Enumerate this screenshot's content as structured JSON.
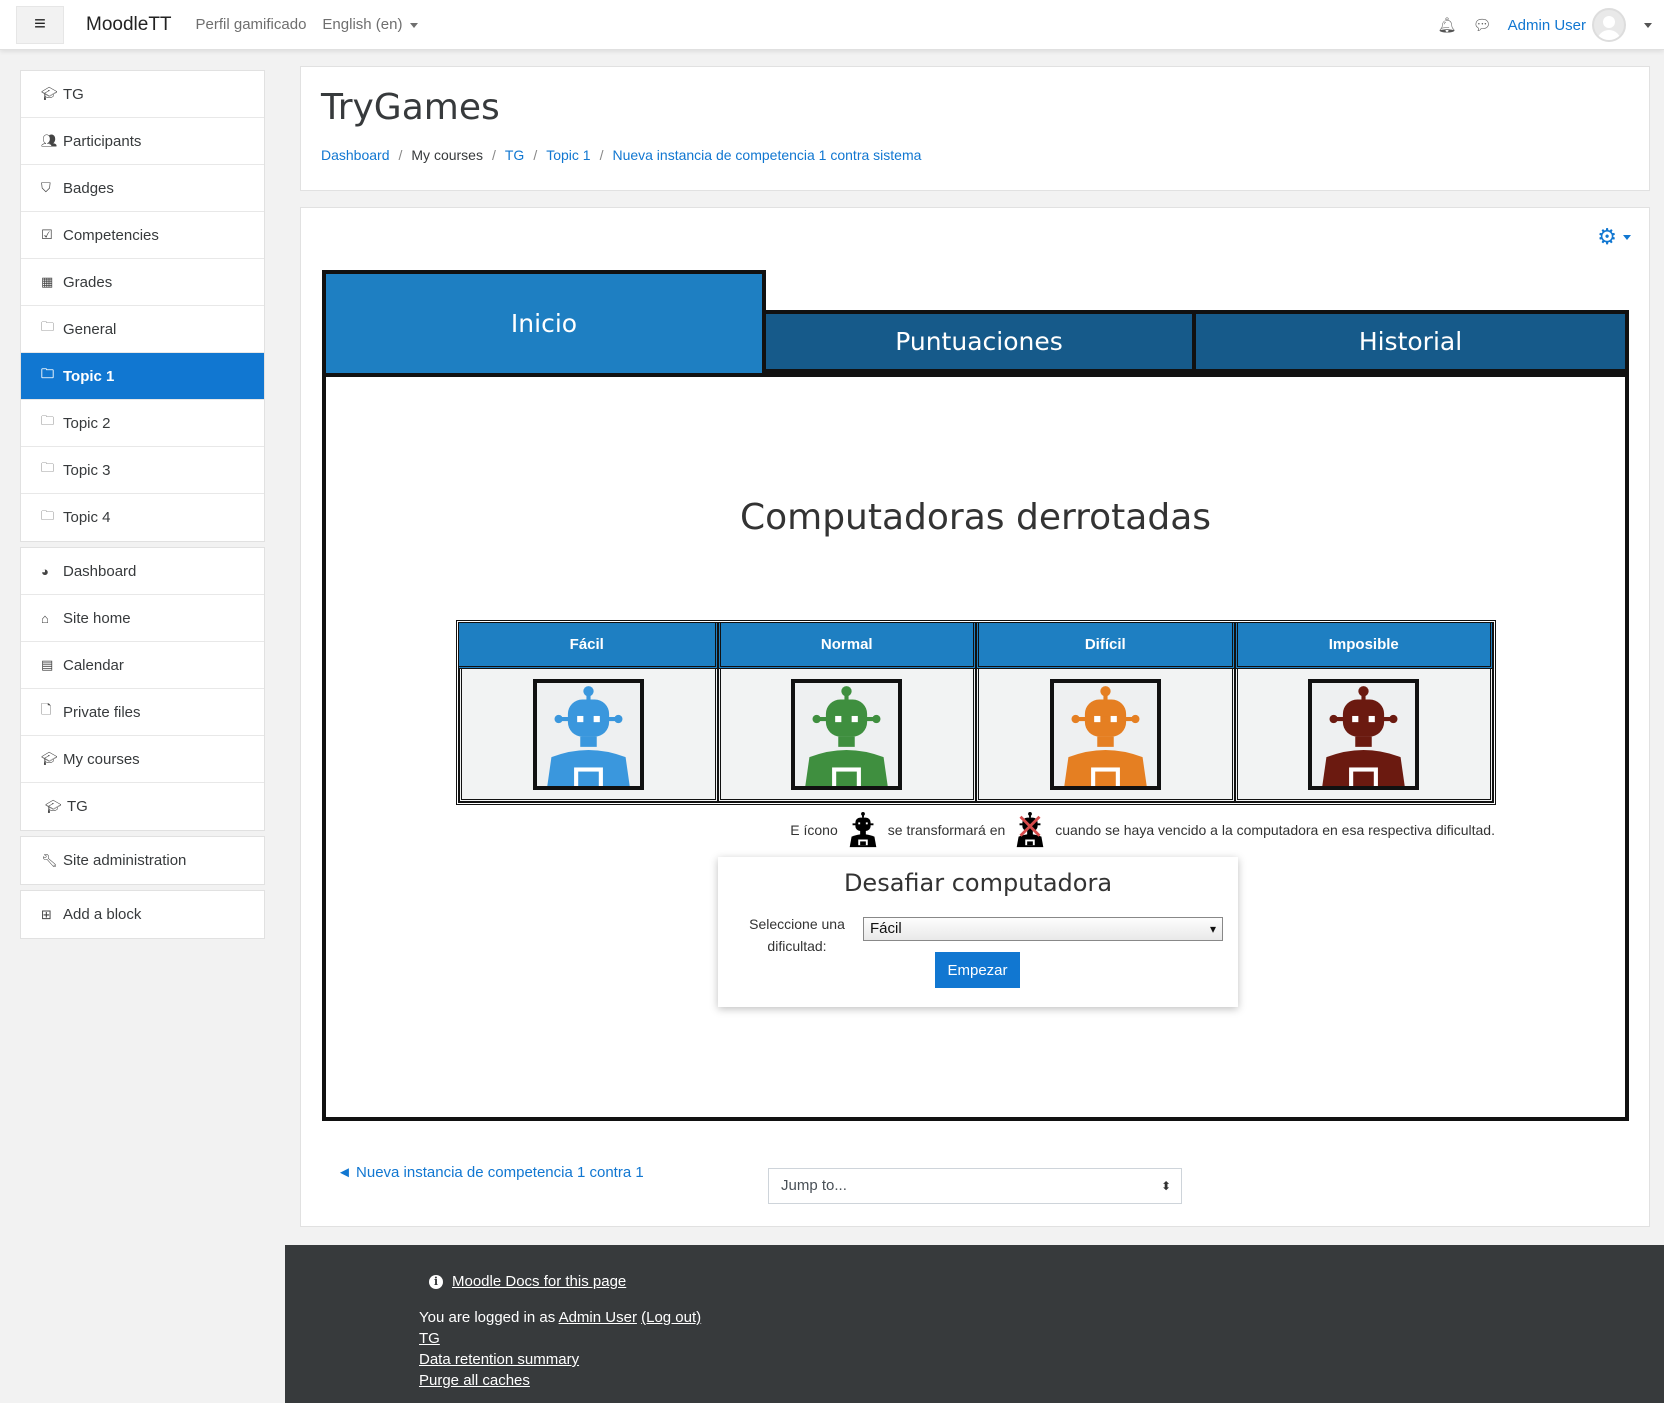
{
  "navbar": {
    "brand": "MoodleTT",
    "links": [
      "Perfil gamificado"
    ],
    "language": "English (en)",
    "user": "Admin User"
  },
  "sidebar": {
    "group1": [
      {
        "label": "TG",
        "icon": "graduation-cap-icon"
      },
      {
        "label": "Participants",
        "icon": "users-icon"
      },
      {
        "label": "Badges",
        "icon": "shield-icon"
      },
      {
        "label": "Competencies",
        "icon": "check-square-icon"
      },
      {
        "label": "Grades",
        "icon": "table-icon"
      },
      {
        "label": "General",
        "icon": "folder-icon"
      },
      {
        "label": "Topic 1",
        "icon": "folder-icon",
        "active": true
      },
      {
        "label": "Topic 2",
        "icon": "folder-icon"
      },
      {
        "label": "Topic 3",
        "icon": "folder-icon"
      },
      {
        "label": "Topic 4",
        "icon": "folder-icon"
      }
    ],
    "group2": [
      {
        "label": "Dashboard",
        "icon": "dashboard-icon"
      },
      {
        "label": "Site home",
        "icon": "home-icon"
      },
      {
        "label": "Calendar",
        "icon": "calendar-icon"
      },
      {
        "label": "Private files",
        "icon": "file-icon"
      },
      {
        "label": "My courses",
        "icon": "graduation-cap-icon"
      },
      {
        "label": "TG",
        "icon": "graduation-cap-icon"
      }
    ],
    "group3": [
      {
        "label": "Site administration",
        "icon": "wrench-icon"
      }
    ],
    "group4": [
      {
        "label": "Add a block",
        "icon": "plus-square-icon"
      }
    ]
  },
  "header": {
    "title": "TryGames",
    "breadcrumb": [
      "Dashboard",
      "My courses",
      "TG",
      "Topic 1",
      "Nueva instancia de competencia 1 contra sistema"
    ]
  },
  "tabs": [
    "Inicio",
    "Puntuaciones",
    "Historial"
  ],
  "panel": {
    "title": "Computadoras derrotadas",
    "difficulties": [
      {
        "label": "Fácil",
        "color": "#3a97dd"
      },
      {
        "label": "Normal",
        "color": "#3f8f3f"
      },
      {
        "label": "Difícil",
        "color": "#e57f22"
      },
      {
        "label": "Imposible",
        "color": "#6b1a10"
      }
    ],
    "legend": {
      "part1": "E ícono",
      "part2": "se transformará en",
      "part3": "cuando se haya vencido a la computadora en esa respectiva dificultad."
    }
  },
  "challenge": {
    "title": "Desafiar computadora",
    "label": "Seleccione una dificultad:",
    "selected": "Fácil",
    "button": "Empezar"
  },
  "bottom": {
    "prev": "◄ Nueva instancia de competencia 1 contra 1",
    "jump": "Jump to..."
  },
  "footer": {
    "docs": "Moodle Docs for this page",
    "logged_prefix": "You are logged in as",
    "user": "Admin User",
    "logout": "(Log out)",
    "links": [
      "TG",
      "Data retention summary",
      "Purge all caches"
    ]
  }
}
